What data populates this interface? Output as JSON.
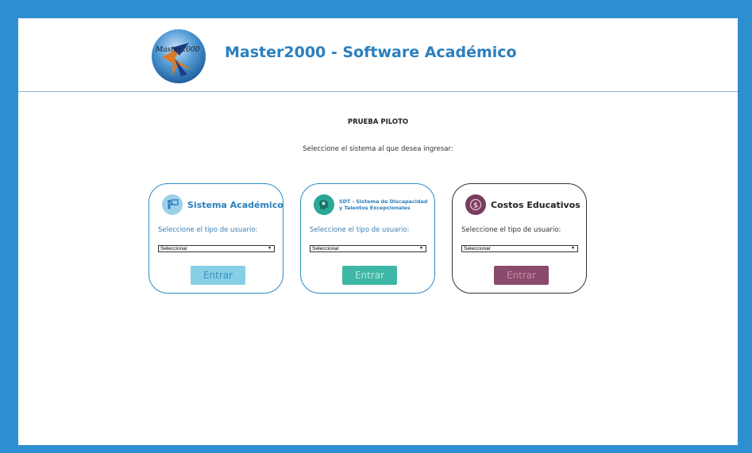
{
  "header": {
    "logo_text": "Master2000",
    "title": "Master2000 - Software Académico"
  },
  "main": {
    "subtitle": "PRUEBA PILOTO",
    "instructions": "Seleccione el sistema al que desea ingresar:"
  },
  "cards": [
    {
      "title": "Sistema Académico",
      "user_label": "Seleccione el tipo de usuario:",
      "select_value": "Seleccionar",
      "button_label": "Entrar",
      "icon": "teacher-board-icon",
      "border_color": "#2a8cc0",
      "title_color": "#2a7fbf",
      "button_color": "#86cfe6",
      "button_text_color": "#3a8fbf"
    },
    {
      "title_line1": "SDT - Sistema de Discapacidad",
      "title_line2": "y Talentos Excepcionales",
      "user_label": "Seleccione el tipo de usuario:",
      "select_value": "Seleccionar",
      "button_label": "Entrar",
      "icon": "head-brain-icon",
      "border_color": "#2a8cc0",
      "title_color": "#2a7fbf",
      "button_color": "#3eb7a6",
      "button_text_color": "#b8ebe1"
    },
    {
      "title": "Costos Educativos",
      "user_label": "Seleccione el tipo de usuario:",
      "select_value": "Seleccionar",
      "button_label": "Entrar",
      "icon": "dollar-coin-icon",
      "border_color": "#333333",
      "title_color": "#222222",
      "button_color": "#8a4a6b",
      "button_text_color": "#c58ba6"
    }
  ]
}
